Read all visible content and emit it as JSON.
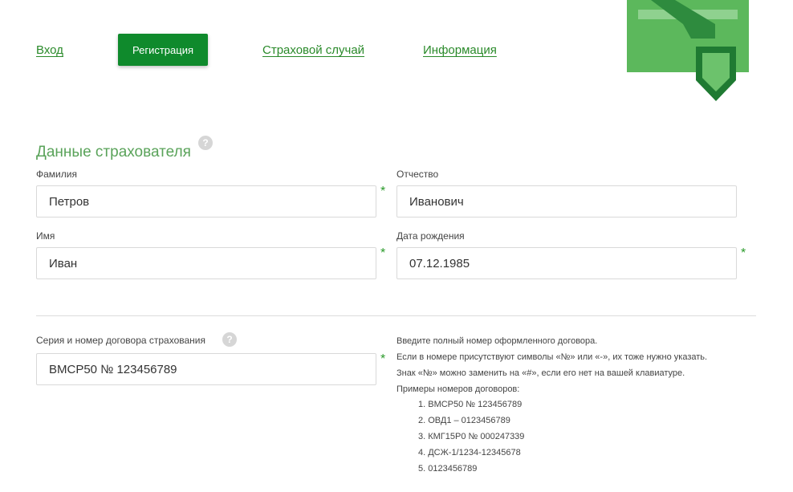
{
  "nav": {
    "login": "Вход",
    "register": "Регистрация",
    "insured_event": "Страховой случай",
    "info": "Информация"
  },
  "section": {
    "title": "Данные страхователя",
    "help": "?"
  },
  "form": {
    "surname_label": "Фамилия",
    "surname_value": "Петров",
    "patronymic_label": "Отчество",
    "patronymic_value": "Иванович",
    "name_label": "Имя",
    "name_value": "Иван",
    "birthdate_label": "Дата рождения",
    "birthdate_value": "07.12.1985",
    "contract_label": "Серия и номер договора страхования",
    "contract_value": "ВМСР50 № 123456789",
    "required_mark": "*"
  },
  "hint": {
    "line1": "Введите полный номер оформленного договора.",
    "line2": "Если в номере присутствуют символы «№» или «-», их тоже нужно указать.",
    "line3": "Знак «№» можно заменить на «#», если его нет на вашей клавиатуре.",
    "examples_title": "Примеры номеров договоров:",
    "examples": [
      "1. ВМСР50 № 123456789",
      "2. ОВД1 – 0123456789",
      "3. КМГ15Р0 № 000247339",
      "4. ДСЖ-1/1234-12345678",
      "5. 0123456789"
    ]
  },
  "colors": {
    "brand_green": "#0f8a2c",
    "link_green": "#2a8a2a",
    "title_green": "#5aa35a"
  }
}
